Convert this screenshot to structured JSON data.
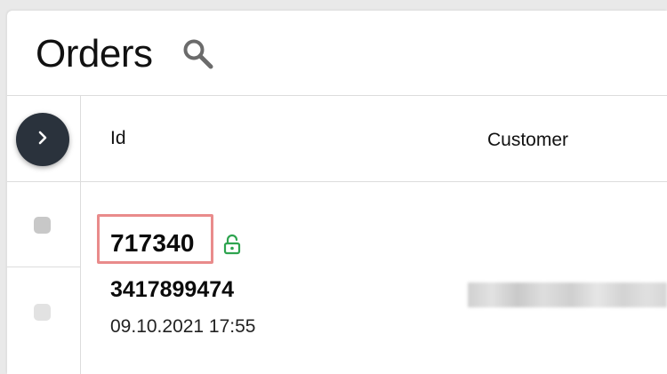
{
  "header": {
    "title": "Orders",
    "search_icon": "search-icon"
  },
  "table": {
    "expand_icon": "chevron-right-icon",
    "columns": [
      {
        "label": "Id"
      },
      {
        "label": "Customer"
      }
    ],
    "rows": [
      {
        "order_id": "717340",
        "lock_icon": "unlocked-padlock-icon",
        "order_number": "3417899474",
        "date": "09.10.2021 17:55",
        "customer": ""
      }
    ]
  },
  "colors": {
    "expand_button_bg": "#2a323c",
    "highlight_border": "#e98b8b",
    "lock_icon": "#2ea44f"
  }
}
